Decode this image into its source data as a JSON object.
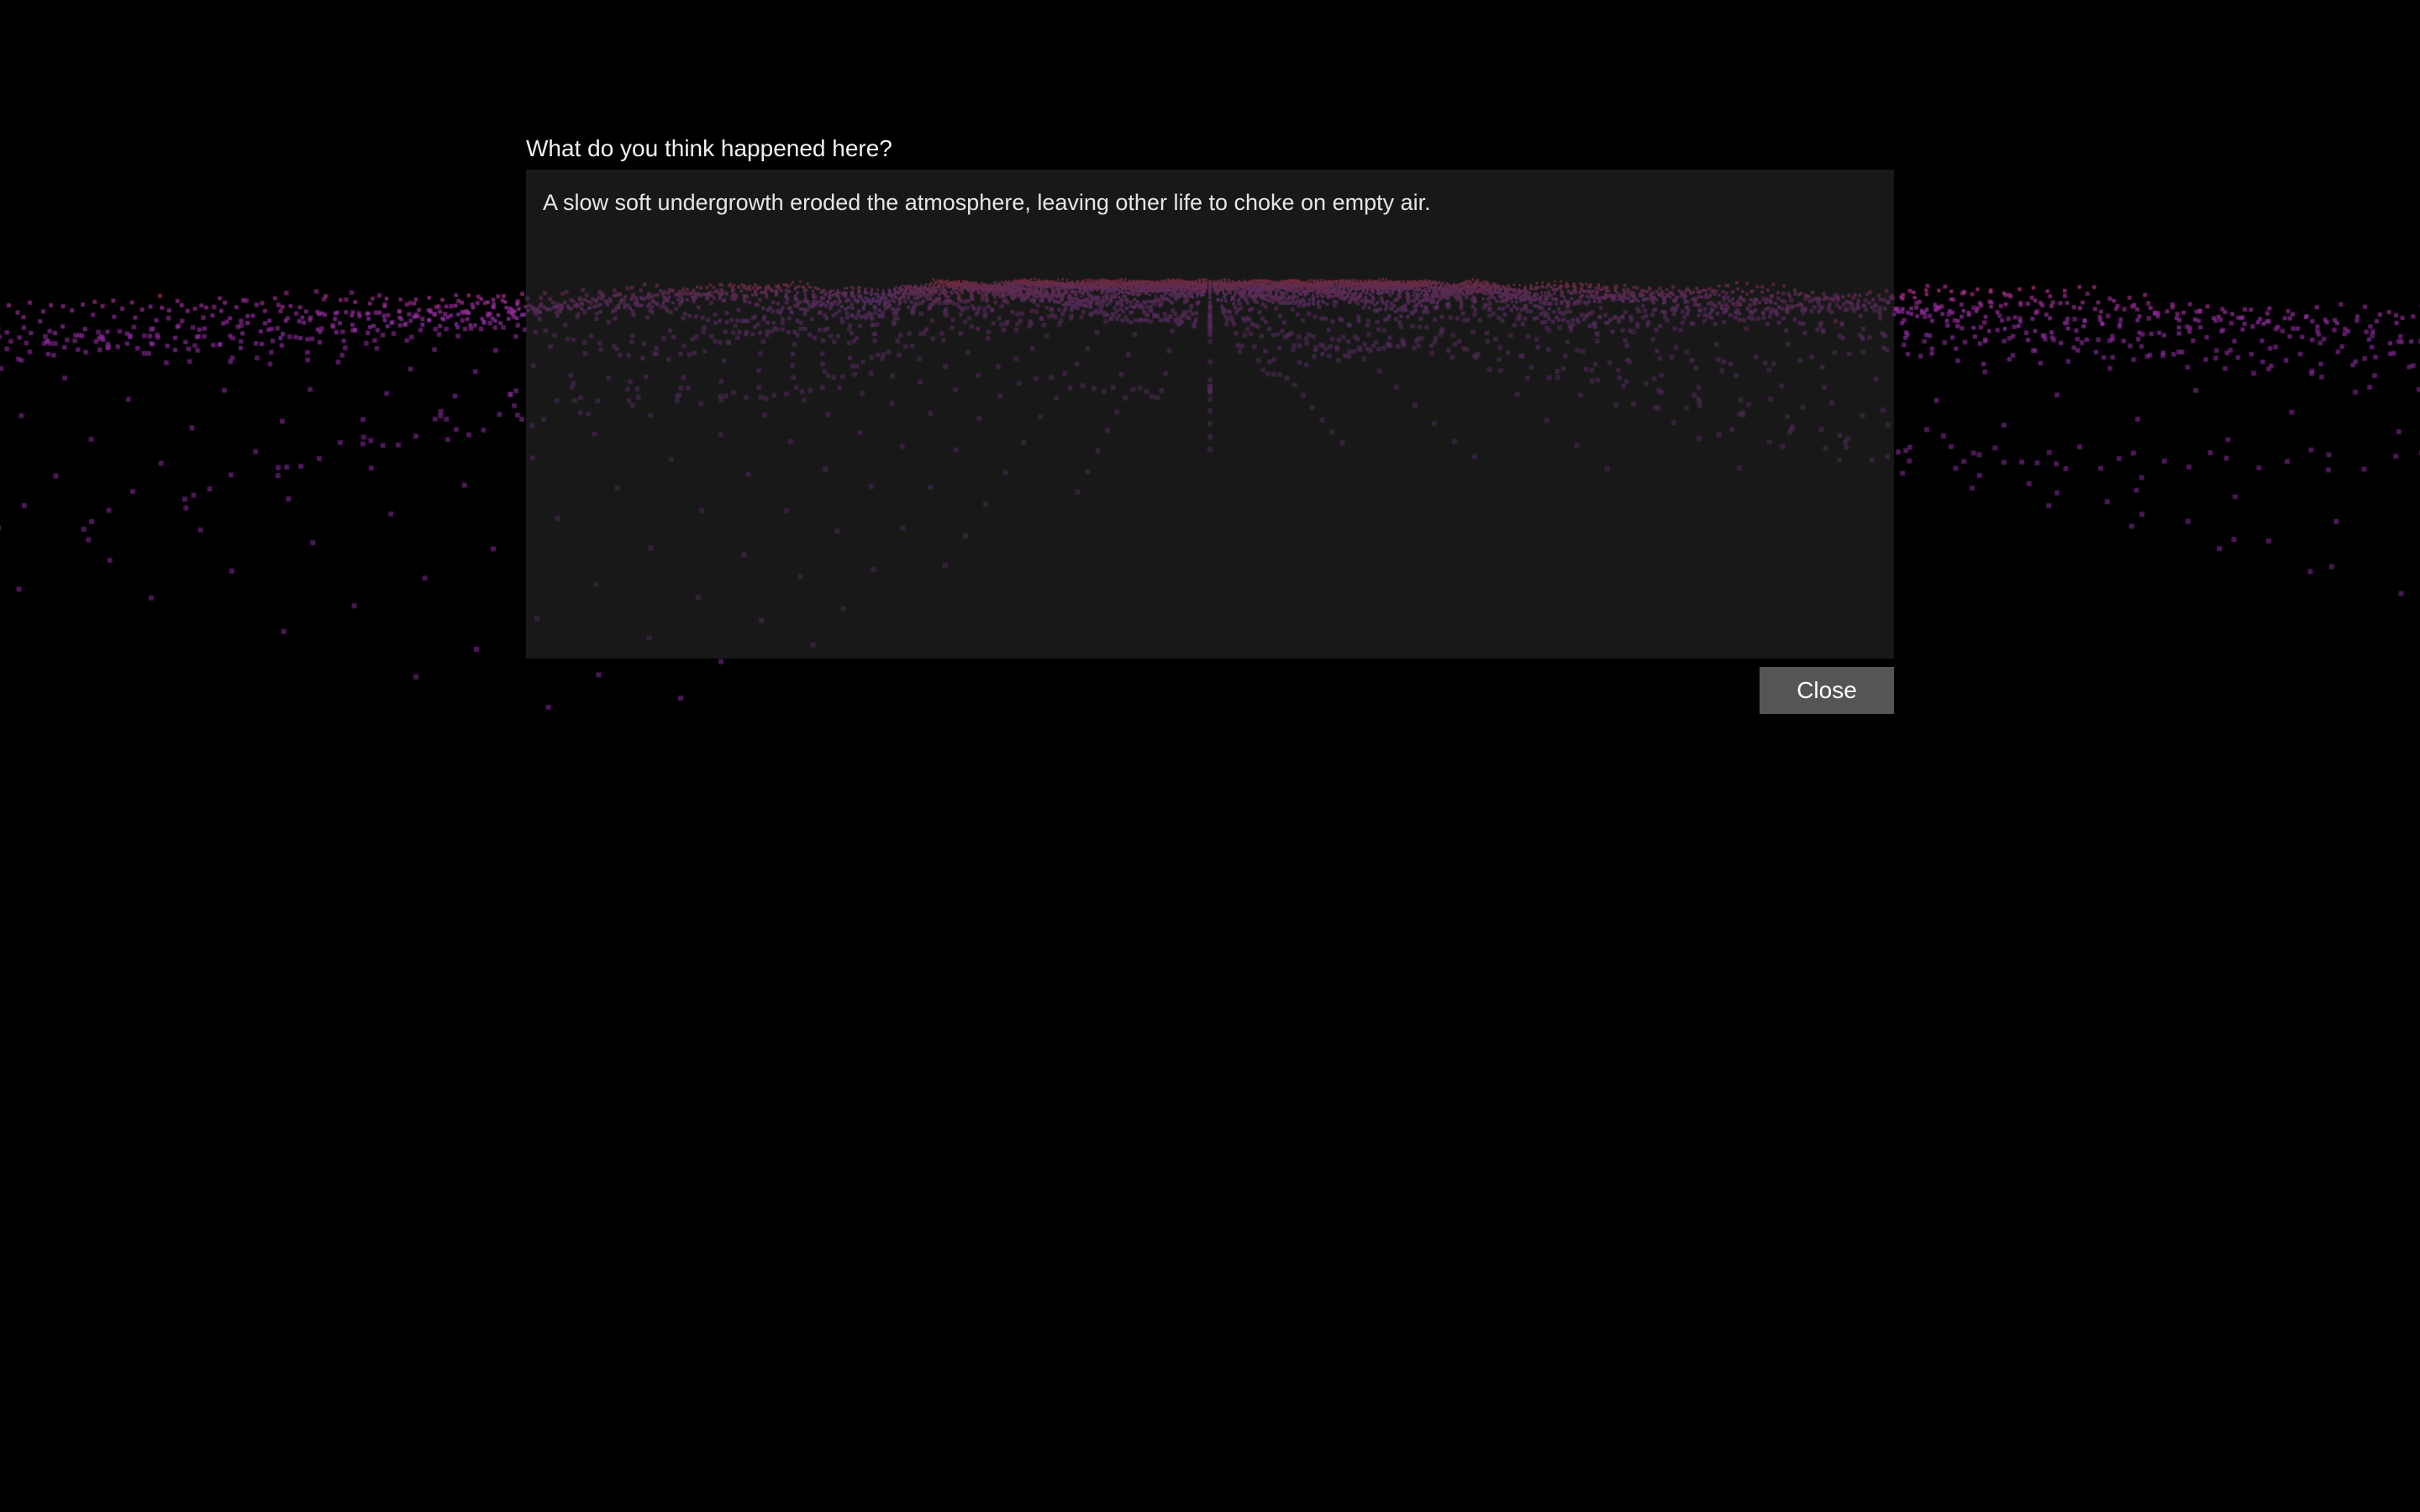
{
  "dialog": {
    "prompt": "What do you think happened here?",
    "response": "A slow soft undergrowth eroded the atmosphere, leaving other life to choke on empty air.",
    "close_label": "Close"
  },
  "colors": {
    "background": "#000000",
    "point_near": "#8a2a9e",
    "point_far_purple": "#9b38c8",
    "point_far_red": "#e0304a",
    "panel": "#282828",
    "button": "#555555"
  }
}
